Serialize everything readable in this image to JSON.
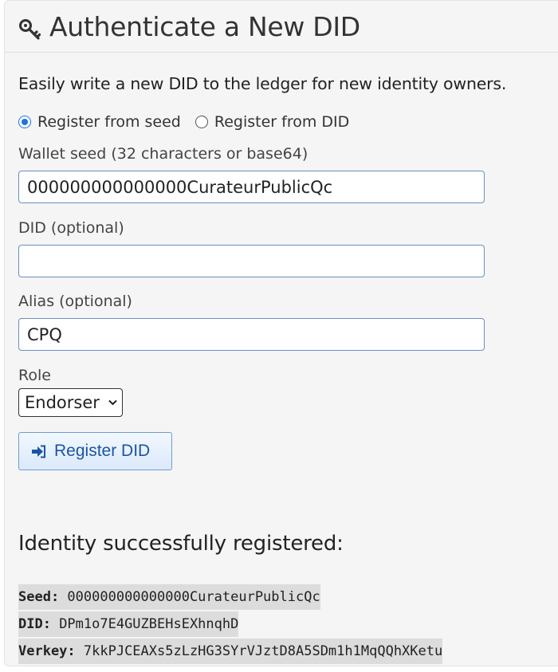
{
  "header": {
    "title": "Authenticate a New DID",
    "icon": "key-icon"
  },
  "intro": "Easily write a new DID to the ledger for new identity owners.",
  "radios": [
    {
      "label": "Register from seed",
      "checked": true
    },
    {
      "label": "Register from DID",
      "checked": false
    }
  ],
  "fields": {
    "seed_label": "Wallet seed (32 characters or base64)",
    "seed_value": "000000000000000CurateurPublicQc",
    "did_label": "DID (optional)",
    "did_value": "",
    "alias_label": "Alias (optional)",
    "alias_value": "CPQ",
    "role_label": "Role",
    "role_value": "Endorser"
  },
  "register_button": {
    "label": "Register DID",
    "icon": "sign-in-icon"
  },
  "result": {
    "title": "Identity successfully registered:",
    "seed_key": "Seed:",
    "seed_value": "000000000000000CurateurPublicQc",
    "did_key": "DID:",
    "did_value": "DPm1o7E4GUZBEHsEXhnqhD",
    "verkey_key": "Verkey:",
    "verkey_value": "7kkPJCEAXs5zLzHG3SYrVJztD8A5SDm1h1MqQQhXKetu"
  },
  "colors": {
    "accent": "#1a73e8",
    "button_text": "#1b55a3",
    "panel_bg": "#f5f5f5",
    "code_bg": "#dcdcdc"
  }
}
